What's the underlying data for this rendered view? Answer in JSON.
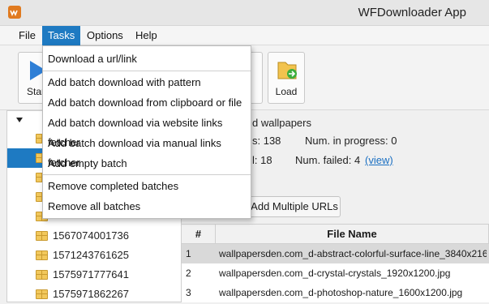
{
  "window": {
    "title": "WFDownloader App"
  },
  "menubar": {
    "items": [
      {
        "label": "File"
      },
      {
        "label": "Tasks"
      },
      {
        "label": "Options"
      },
      {
        "label": "Help"
      }
    ]
  },
  "toolbar": {
    "start_label": "Start",
    "load_label": "Load"
  },
  "tasks_menu": {
    "items": [
      {
        "label": "Download a url/link"
      },
      {
        "label": "Add batch download with pattern"
      },
      {
        "label": "Add batch download from clipboard or file"
      },
      {
        "label": "Add batch download via website links fetcher"
      },
      {
        "label": "Add batch download via manual links fetcher"
      },
      {
        "label": "Add empty batch"
      },
      {
        "label": "Remove completed batches"
      },
      {
        "label": "Remove all batches"
      }
    ]
  },
  "tree": {
    "items": [
      {
        "label": "1567074001736"
      },
      {
        "label": "1571243761625"
      },
      {
        "label": "1575971777641"
      },
      {
        "label": "1575971862267"
      }
    ]
  },
  "batch_info": {
    "name_partial": "d wallpapers",
    "total_partial": "s:  138",
    "in_progress": "Num. in progress:  0",
    "completed_partial": "l:  18",
    "failed": "Num. failed:  4",
    "view_link": "(view)"
  },
  "add_urls_button": "Add Multiple URLs",
  "files_table": {
    "columns": [
      "#",
      "File Name"
    ],
    "rows": [
      {
        "num": "1",
        "name": "wallpapersden.com_d-abstract-colorful-surface-line_3840x216..."
      },
      {
        "num": "2",
        "name": "wallpapersden.com_d-crystal-crystals_1920x1200.jpg"
      },
      {
        "num": "3",
        "name": "wallpapersden.com_d-photoshop-nature_1600x1200.jpg"
      }
    ]
  },
  "colors": {
    "accent": "#1e7ac2",
    "link": "#1a6fc2",
    "folder": "#f2c85c"
  }
}
